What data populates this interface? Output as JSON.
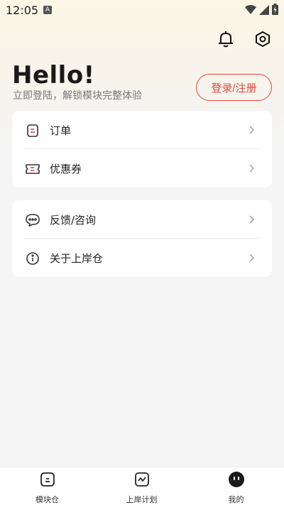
{
  "status_bar": {
    "time": "12:05",
    "a_badge": "A",
    "icons": [
      "wifi-icon",
      "signal-icon",
      "battery-icon"
    ]
  },
  "header": {
    "icons": [
      "bell-icon",
      "settings-icon"
    ],
    "greeting": "Hello!",
    "subtitle": "立即登陆，解锁模块完整体验",
    "login_button": "登录/注册"
  },
  "menu_group_1": [
    {
      "label": "订单",
      "icon": "order-icon"
    },
    {
      "label": "优惠券",
      "icon": "coupon-icon"
    }
  ],
  "menu_group_2": [
    {
      "label": "反馈/咨询",
      "icon": "chat-icon"
    },
    {
      "label": "关于上岸仓",
      "icon": "info-icon"
    }
  ],
  "tabbar": [
    {
      "label": "模块仓",
      "icon": "module-icon"
    },
    {
      "label": "上岸计划",
      "icon": "plan-chart-icon"
    },
    {
      "label": "我的",
      "icon": "profile-icon"
    }
  ],
  "colors": {
    "accent": "#e0493f",
    "text": "#222222",
    "subtext": "#777777",
    "background": "#f5f5f5",
    "card": "#ffffff"
  }
}
